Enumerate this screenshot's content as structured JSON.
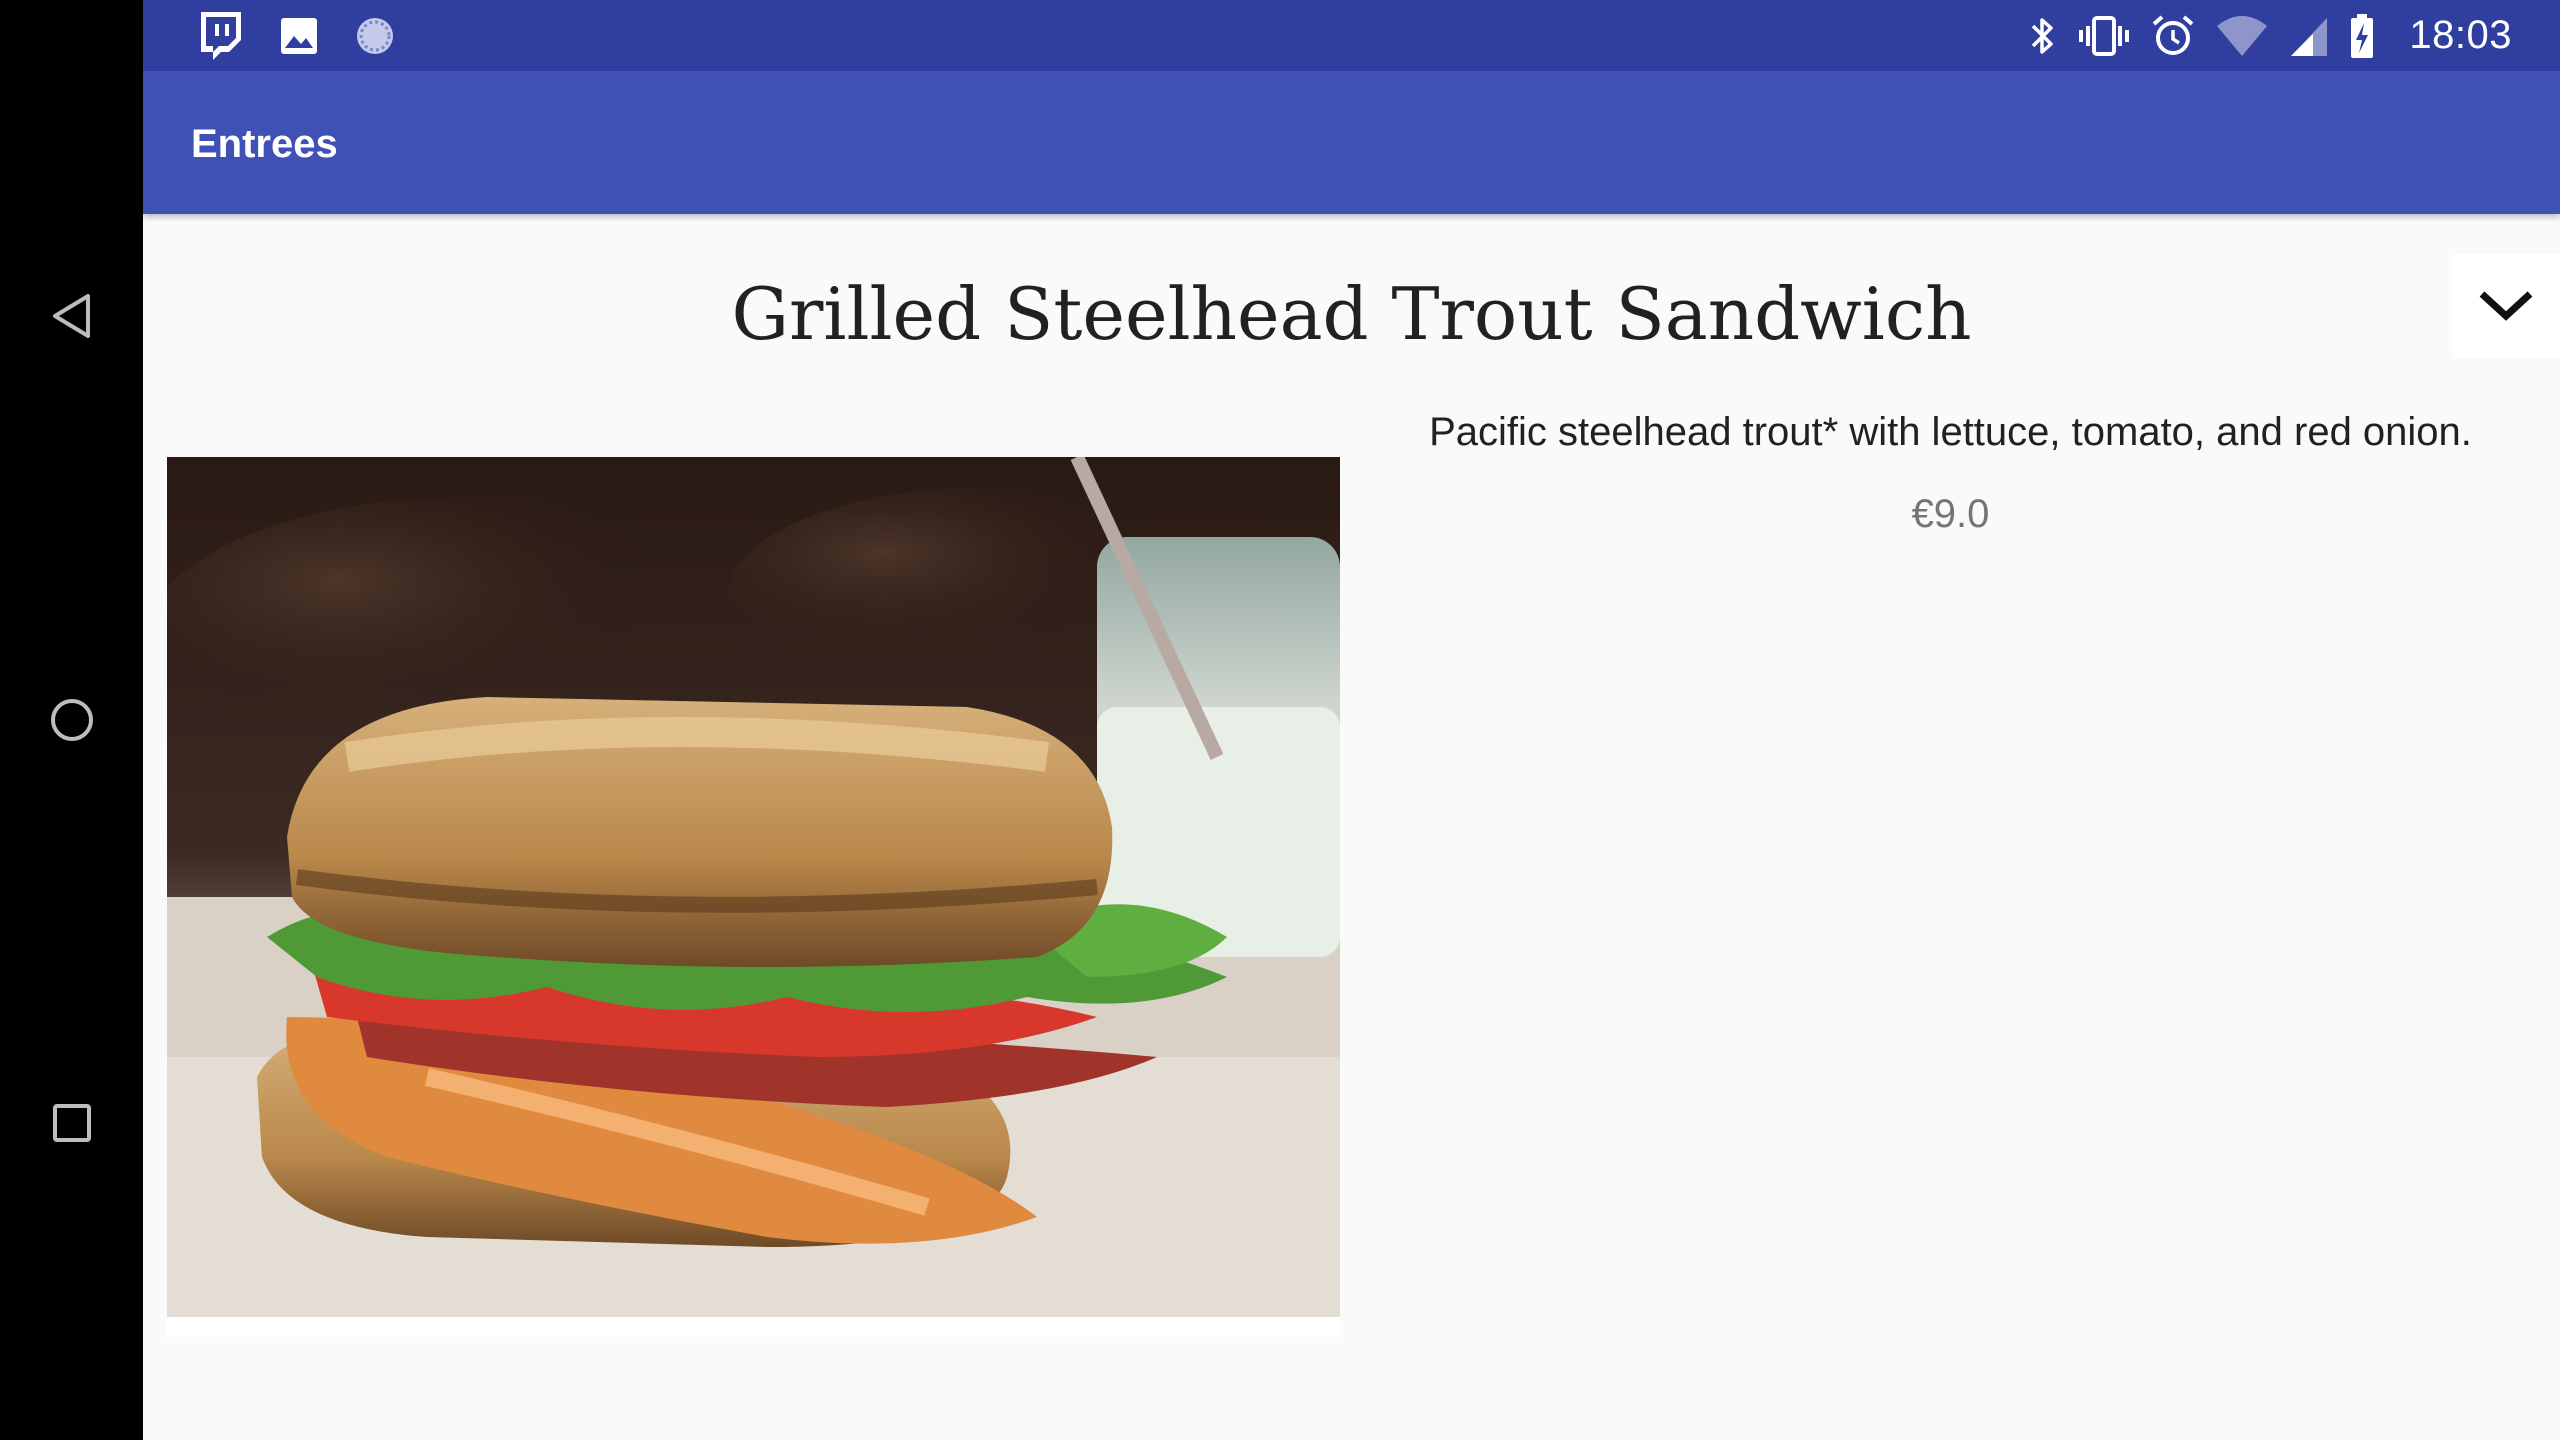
{
  "status_bar": {
    "time": "18:03",
    "left_icons": [
      "twitch-icon",
      "image-icon",
      "sync-icon"
    ],
    "right_icons": [
      "bluetooth-icon",
      "vibrate-icon",
      "alarm-icon",
      "wifi-icon",
      "signal-icon",
      "battery-charging-icon"
    ]
  },
  "app_bar": {
    "title": "Entrees"
  },
  "item": {
    "title": "Grilled Steelhead Trout Sandwich",
    "description": "Pacific steelhead trout* with lettuce, tomato, and red onion.",
    "price": "€9.0"
  },
  "colors": {
    "status_bar": "#303f9f",
    "app_bar": "#3f51b5",
    "background": "#fafafa",
    "nav_bar": "#000000"
  }
}
